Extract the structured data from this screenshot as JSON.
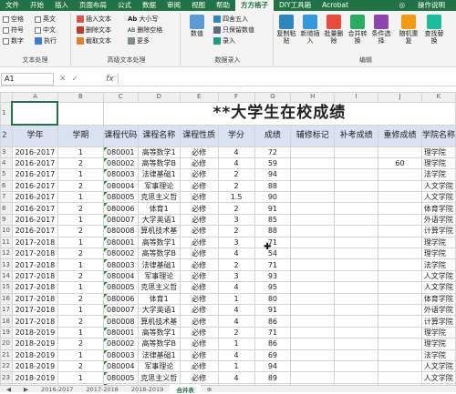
{
  "ribbon_tabs": [
    "文件",
    "开始",
    "插入",
    "页面布局",
    "公式",
    "数据",
    "审阅",
    "视图",
    "帮助",
    "方方格子",
    "DIY工具箱",
    "Acrobat"
  ],
  "active_tab_index": 9,
  "tell_me": "操作说明",
  "text_group": {
    "label": "文本处理",
    "checkboxes": [
      "空格",
      "英文",
      "符号",
      "中文",
      "数字"
    ],
    "exec_label": "执行"
  },
  "adv_text_group": {
    "label": "高级文本处理",
    "items": [
      "插入文本",
      "删除文本",
      "截取文本",
      "大小写",
      "删除空格",
      "更多"
    ]
  },
  "data_input_group": {
    "label": "数据录入",
    "items": [
      "数值",
      "四舍五入",
      "只保留数值",
      "录入"
    ]
  },
  "edit_group": {
    "label": "编辑",
    "items": [
      "复制粘贴",
      "新增插入",
      "批量删除",
      "合并转换",
      "条件选择",
      "随机重复",
      "查找替换"
    ]
  },
  "formula_bar": {
    "name_box": "A1",
    "fx": "fx",
    "value": ""
  },
  "columns": [
    "A",
    "B",
    "C",
    "D",
    "E",
    "F",
    "G",
    "H",
    "I",
    "J",
    "K"
  ],
  "title": "**大学生在校成绩",
  "headers": [
    "学年",
    "学期",
    "课程代码",
    "课程名称",
    "课程性质",
    "学分",
    "成绩",
    "辅修标记",
    "补考成绩",
    "重修成绩",
    "学院名称"
  ],
  "rows": [
    {
      "n": "3",
      "cells": [
        "2016-2017",
        "1",
        "080001",
        "高等数学1",
        "必修",
        "4",
        "72",
        "",
        "",
        "",
        "理学院"
      ]
    },
    {
      "n": "4",
      "cells": [
        "2016-2017",
        "2",
        "080002",
        "高等数学B",
        "必修",
        "4",
        "59",
        "",
        "",
        "60",
        "理学院"
      ]
    },
    {
      "n": "5",
      "cells": [
        "2016-2017",
        "1",
        "080003",
        "法律基础1",
        "必修",
        "2",
        "94",
        "",
        "",
        "",
        "法学院"
      ]
    },
    {
      "n": "6",
      "cells": [
        "2016-2017",
        "2",
        "080004",
        "军事理论",
        "必修",
        "2",
        "88",
        "",
        "",
        "",
        "人文学院"
      ]
    },
    {
      "n": "7",
      "cells": [
        "2016-2017",
        "1",
        "080005",
        "克思主义哲",
        "必修",
        "1.5",
        "90",
        "",
        "",
        "",
        "人文学院"
      ]
    },
    {
      "n": "8",
      "cells": [
        "2016-2017",
        "2",
        "080006",
        "体育1",
        "必修",
        "2",
        "91",
        "",
        "",
        "",
        "体育学院"
      ]
    },
    {
      "n": "9",
      "cells": [
        "2016-2017",
        "1",
        "080007",
        "大学英语1",
        "必修",
        "3",
        "85",
        "",
        "",
        "",
        "外语学院"
      ]
    },
    {
      "n": "10",
      "cells": [
        "2016-2017",
        "2",
        "080008",
        "算机技术基",
        "必修",
        "2",
        "88",
        "",
        "",
        "",
        "计算学院"
      ]
    },
    {
      "n": "11",
      "cells": [
        "2017-2018",
        "1",
        "080001",
        "高等数学1",
        "必修",
        "3",
        "71",
        "",
        "",
        "",
        "理学院"
      ]
    },
    {
      "n": "12",
      "cells": [
        "2017-2018",
        "2",
        "080002",
        "高等数学B",
        "必修",
        "4",
        "54",
        "",
        "",
        "",
        "理学院"
      ]
    },
    {
      "n": "13",
      "cells": [
        "2017-2018",
        "1",
        "080003",
        "法律基础1",
        "必修",
        "2",
        "71",
        "",
        "",
        "",
        "法学院"
      ]
    },
    {
      "n": "14",
      "cells": [
        "2017-2018",
        "2",
        "080004",
        "军事理论",
        "必修",
        "3",
        "93",
        "",
        "",
        "",
        "人文学院"
      ]
    },
    {
      "n": "15",
      "cells": [
        "2017-2018",
        "1",
        "080005",
        "克思主义哲",
        "必修",
        "4",
        "95",
        "",
        "",
        "",
        "人文学院"
      ]
    },
    {
      "n": "16",
      "cells": [
        "2017-2018",
        "2",
        "080006",
        "体育1",
        "必修",
        "1",
        "80",
        "",
        "",
        "",
        "体育学院"
      ]
    },
    {
      "n": "17",
      "cells": [
        "2017-2018",
        "1",
        "080007",
        "大学英语1",
        "必修",
        "4",
        "91",
        "",
        "",
        "",
        "外语学院"
      ]
    },
    {
      "n": "18",
      "cells": [
        "2017-2018",
        "2",
        "080008",
        "算机技术基",
        "必修",
        "4",
        "86",
        "",
        "",
        "",
        "计算学院"
      ]
    },
    {
      "n": "19",
      "cells": [
        "2018-2019",
        "1",
        "080001",
        "高等数学1",
        "必修",
        "2",
        "71",
        "",
        "",
        "",
        "理学院"
      ]
    },
    {
      "n": "20",
      "cells": [
        "2018-2019",
        "2",
        "080002",
        "高等数学B",
        "必修",
        "1",
        "86",
        "",
        "",
        "",
        "理学院"
      ]
    },
    {
      "n": "21",
      "cells": [
        "2018-2019",
        "1",
        "080003",
        "法律基础1",
        "必修",
        "4",
        "69",
        "",
        "",
        "",
        "法学院"
      ]
    },
    {
      "n": "22",
      "cells": [
        "2018-2019",
        "2",
        "080004",
        "军事理论",
        "必修",
        "1",
        "94",
        "",
        "",
        "",
        "人文学院"
      ]
    },
    {
      "n": "23",
      "cells": [
        "2018-2019",
        "1",
        "080005",
        "克思主义哲",
        "必修",
        "4",
        "89",
        "",
        "",
        "",
        "人文学院"
      ]
    },
    {
      "n": "24",
      "cells": [
        "2018-2019",
        "2",
        "080006",
        "体育1",
        "必修",
        "1",
        "80",
        "",
        "",
        "",
        "体育学院"
      ]
    },
    {
      "n": "25",
      "cells": [
        "2018-2019",
        "1",
        "080007",
        "大学英语1",
        "必修",
        "3",
        "95",
        "",
        "",
        "",
        "外语学院"
      ]
    }
  ],
  "sheet_tabs": [
    "2016-2017",
    "2017-2018",
    "2018-2019",
    "合并表"
  ],
  "active_sheet_index": 3,
  "colors": {
    "accent": "#217346",
    "header_fill": "#d9e1f2"
  }
}
